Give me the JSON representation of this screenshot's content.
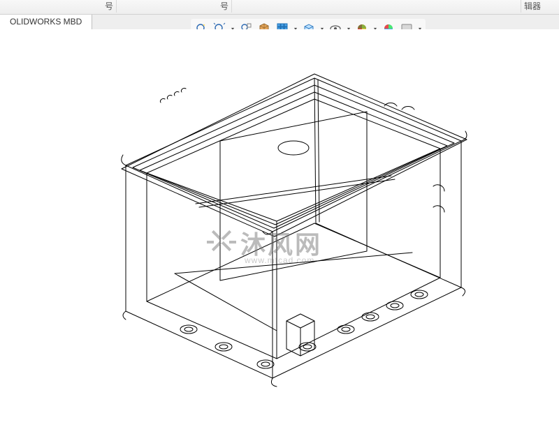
{
  "top": {
    "field1_label": "号",
    "field2_label": "号",
    "right_label": "辑器"
  },
  "tab": {
    "active": "OLIDWORKS MBD"
  },
  "toolbar": {
    "icons": [
      {
        "name": "zoom-in-icon"
      },
      {
        "name": "zoom-fit-icon"
      },
      {
        "name": "zoom-window-icon"
      },
      {
        "name": "section-view-icon"
      },
      {
        "name": "orientation-icon"
      },
      {
        "name": "display-style-icon"
      },
      {
        "name": "hide-show-icon"
      },
      {
        "name": "appearance-icon"
      },
      {
        "name": "scene-icon"
      },
      {
        "name": "render-icon"
      }
    ]
  },
  "watermark": {
    "text": "沐风网",
    "url": "www.mfcad.com"
  }
}
